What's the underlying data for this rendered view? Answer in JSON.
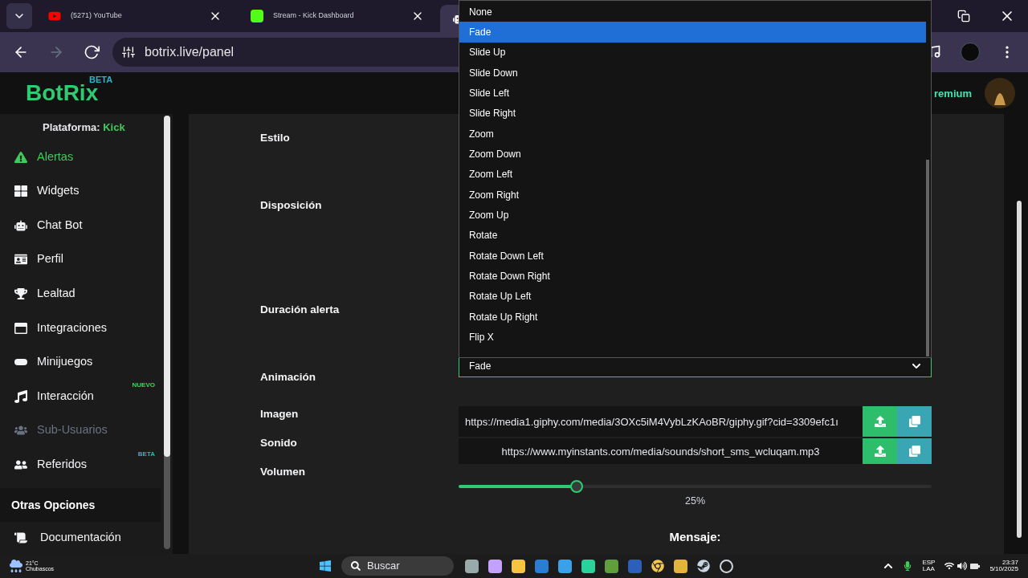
{
  "browser": {
    "tabs": [
      {
        "title": "(5271) YouTube",
        "selected": false,
        "kind": "youtube"
      },
      {
        "title": "Stream - Kick Dashboard",
        "selected": false,
        "kind": "kick"
      },
      {
        "selected": true,
        "kind": "bot"
      }
    ],
    "url": "botrix.live/panel"
  },
  "header": {
    "logo": "BotRix",
    "logo_badge": "BETA",
    "plan": "remium"
  },
  "sidebar": {
    "platform_label": "Plataforma:",
    "platform": "Kick",
    "items": [
      {
        "label": "Alertas",
        "selected": true,
        "disabled": false
      },
      {
        "label": "Widgets",
        "selected": false,
        "disabled": false
      },
      {
        "label": "Chat Bot",
        "selected": false,
        "disabled": false
      },
      {
        "label": "Perfil",
        "selected": false,
        "disabled": false
      },
      {
        "label": "Lealtad",
        "selected": false,
        "disabled": false
      },
      {
        "label": "Integraciones",
        "selected": false,
        "disabled": false
      },
      {
        "label": "Minijuegos",
        "selected": false,
        "disabled": false
      },
      {
        "label": "Interacción",
        "selected": false,
        "disabled": false,
        "badge": {
          "text": "NUEVO",
          "color": "#22e05a"
        }
      },
      {
        "label": "Sub-Usuarios",
        "selected": false,
        "disabled": true
      },
      {
        "label": "Referidos",
        "selected": false,
        "disabled": false,
        "badge": {
          "text": "BETA",
          "color": "#2fb3c9"
        }
      }
    ],
    "section": "Otras Opciones",
    "other_items": [
      {
        "label": "Documentación"
      }
    ]
  },
  "form": {
    "labels": [
      "Estilo",
      "Disposición",
      "Duración alerta",
      "Animación",
      "Imagen",
      "Sonido",
      "Volumen"
    ],
    "animation": {
      "value": "Fade",
      "options": [
        {
          "label": "None",
          "selected": false
        },
        {
          "label": "Fade",
          "selected": true
        },
        {
          "label": "Slide Up",
          "selected": false
        },
        {
          "label": "Slide Down",
          "selected": false
        },
        {
          "label": "Slide Left",
          "selected": false
        },
        {
          "label": "Slide Right",
          "selected": false
        },
        {
          "label": "Zoom",
          "selected": false
        },
        {
          "label": "Zoom Down",
          "selected": false
        },
        {
          "label": "Zoom Left",
          "selected": false
        },
        {
          "label": "Zoom Right",
          "selected": false
        },
        {
          "label": "Zoom Up",
          "selected": false
        },
        {
          "label": "Rotate",
          "selected": false
        },
        {
          "label": "Rotate Down Left",
          "selected": false
        },
        {
          "label": "Rotate Down Right",
          "selected": false
        },
        {
          "label": "Rotate Up Left",
          "selected": false
        },
        {
          "label": "Rotate Up Right",
          "selected": false
        },
        {
          "label": "Flip X",
          "selected": false
        }
      ]
    },
    "image_url": "https://media1.giphy.com/media/3OXc5iM4VybLzKAoBR/giphy.gif?cid=3309efc1ı",
    "sound_url": "https://www.myinstants.com/media/sounds/short_sms_wcluqam.mp3",
    "volume": {
      "level": 0.25,
      "reading": "25%"
    },
    "message_label": "Mensaje:"
  },
  "taskbar": {
    "temp": "21°C",
    "weather": "Chubascos",
    "search": "Buscar",
    "lang": "ESP",
    "region": "LAA",
    "time": "23:37",
    "date": "5/10/2025"
  }
}
